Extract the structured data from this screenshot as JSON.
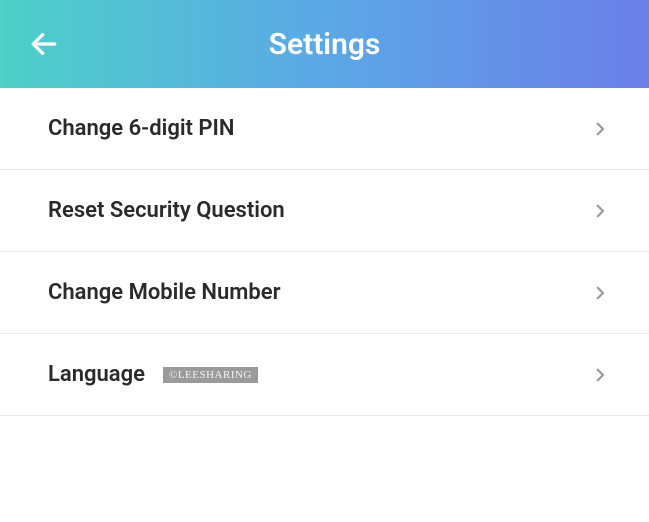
{
  "header": {
    "title": "Settings"
  },
  "settings": {
    "items": [
      {
        "label": "Change 6-digit PIN"
      },
      {
        "label": "Reset Security Question"
      },
      {
        "label": "Change Mobile Number"
      },
      {
        "label": "Language"
      }
    ]
  },
  "watermark": {
    "text": "©LEESHARING"
  }
}
